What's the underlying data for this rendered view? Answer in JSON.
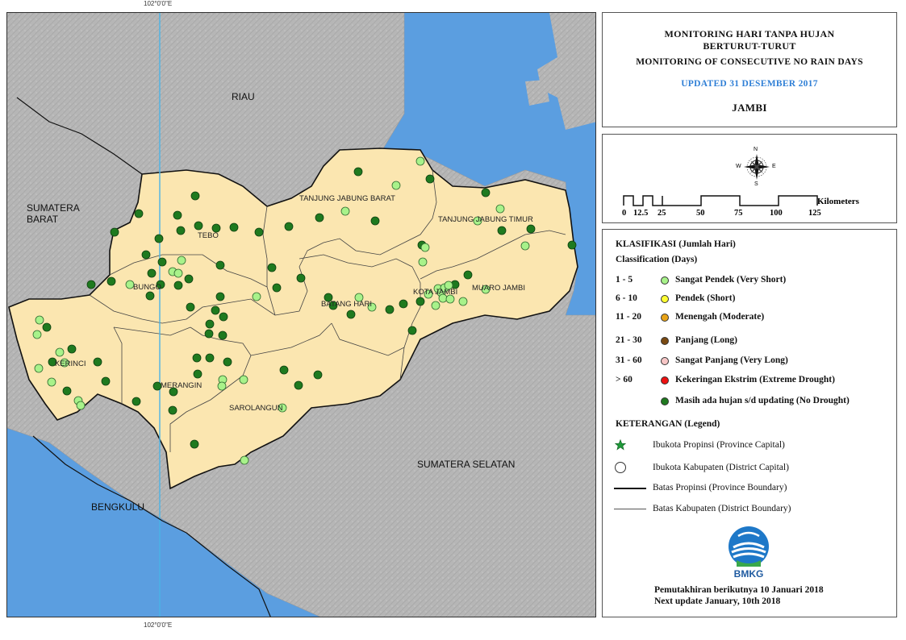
{
  "graticule": {
    "top": "102°0'0\"E",
    "bottom": "102°0'0\"E"
  },
  "regions": {
    "riau": "RIAU",
    "sumbar": [
      "SUMATERA",
      "BARAT"
    ],
    "bengkulu": "BENGKULU",
    "sumsel": "SUMATERA SELATAN"
  },
  "districts": {
    "tjb": "TANJUNG JABUNG BARAT",
    "tjt": "TANJUNG JABUNG TIMUR",
    "tebo": "TEBO",
    "bungo": "BUNGO",
    "kota": "KOTA JAMBI",
    "muaro": "MUARO JAMBI",
    "bh": "BATANG HARI",
    "kerinci": "KERINCI",
    "merangin": "MERANGIN",
    "sarolangun": "SAROLANGUN"
  },
  "title": {
    "line1": "MONITORING HARI TANPA HUJAN",
    "line2": "BERTURUT-TURUT",
    "line3": "MONITORING OF CONSECUTIVE NO RAIN DAYS",
    "updated": "UPDATED 31 DESEMBER 2017",
    "province": "JAMBI"
  },
  "compass": {
    "n": "N",
    "s": "S",
    "e": "E",
    "w": "W"
  },
  "scale": {
    "unit": "Kilometers",
    "ticks": [
      "0",
      "12.5",
      "25",
      "50",
      "75",
      "100",
      "125"
    ]
  },
  "classification": {
    "title": "KLASIFIKASI (Jumlah Hari)",
    "subtitle": "Classification (Days)",
    "items": [
      {
        "code": "1 - 5",
        "label": "Sangat Pendek (Very Short)",
        "color": "#a8f28a"
      },
      {
        "code": "6 - 10",
        "label": "Pendek (Short)",
        "color": "#ffff33"
      },
      {
        "code": "11 - 20",
        "label": "Menengah (Moderate)",
        "color": "#e8a317"
      },
      {
        "code": "21 - 30",
        "label": "Panjang (Long)",
        "color": "#7a4a12"
      },
      {
        "code": "31 - 60",
        "label": "Sangat Panjang (Very Long)",
        "color": "#f7c6c6"
      },
      {
        "code": "> 60",
        "label": "Kekeringan Ekstrim (Extreme Drought)",
        "color": "#ee1111"
      },
      {
        "code": "",
        "label": "Masih ada hujan s/d updating (No Drought)",
        "color": "#1f7a1f"
      }
    ]
  },
  "legend": {
    "title": "KETERANGAN (Legend)",
    "capital": "Ibukota Propinsi (Province Capital)",
    "district_capital": "Ibukota Kabupaten (District Capital)",
    "prov_boundary": "Batas Propinsi (Province Boundary)",
    "dist_boundary": "Batas Kabupaten (District Boundary)"
  },
  "logo": {
    "text": "BMKG"
  },
  "footer": {
    "line1": "Pemutakhiran berikutnya 10 Januari 2018",
    "line2": "Next update January, 10th 2018"
  },
  "colors": {
    "sea": "#5b9ee0",
    "land": "#b5b5b5",
    "jambi": "#fbe6b0",
    "no_drought": "#1f7a1f",
    "very_short": "#a8f28a"
  },
  "stations": {
    "light": [
      [
        520,
        199
      ],
      [
        526,
        306
      ],
      [
        523,
        324
      ],
      [
        490,
        229
      ],
      [
        427,
        261
      ],
      [
        591,
        273
      ],
      [
        619,
        258
      ],
      [
        650,
        304
      ],
      [
        542,
        357
      ],
      [
        546,
        362
      ],
      [
        550,
        356
      ],
      [
        555,
        353
      ],
      [
        548,
        369
      ],
      [
        539,
        378
      ],
      [
        557,
        370
      ],
      [
        573,
        373
      ],
      [
        601,
        358
      ],
      [
        317,
        367
      ],
      [
        444,
        368
      ],
      [
        460,
        380
      ],
      [
        530,
        364
      ],
      [
        224,
        322
      ],
      [
        213,
        336
      ],
      [
        220,
        338
      ],
      [
        160,
        352
      ],
      [
        48,
        396
      ],
      [
        45,
        414
      ],
      [
        73,
        436
      ],
      [
        79,
        449
      ],
      [
        47,
        456
      ],
      [
        63,
        473
      ],
      [
        96,
        496
      ],
      [
        99,
        502
      ],
      [
        275,
        470
      ],
      [
        301,
        470
      ],
      [
        274,
        478
      ],
      [
        302,
        570
      ],
      [
        349,
        505
      ]
    ],
    "dark": [
      [
        443,
        212
      ],
      [
        532,
        221
      ],
      [
        601,
        238
      ],
      [
        464,
        273
      ],
      [
        395,
        269
      ],
      [
        357,
        280
      ],
      [
        621,
        285
      ],
      [
        657,
        283
      ],
      [
        708,
        303
      ],
      [
        522,
        303
      ],
      [
        579,
        340
      ],
      [
        563,
        352
      ],
      [
        520,
        373
      ],
      [
        499,
        376
      ],
      [
        482,
        383
      ],
      [
        510,
        409
      ],
      [
        434,
        389
      ],
      [
        412,
        378
      ],
      [
        406,
        368
      ],
      [
        372,
        344
      ],
      [
        336,
        331
      ],
      [
        320,
        287
      ],
      [
        289,
        281
      ],
      [
        267,
        282
      ],
      [
        245,
        279
      ],
      [
        223,
        285
      ],
      [
        219,
        266
      ],
      [
        241,
        242
      ],
      [
        196,
        295
      ],
      [
        171,
        264
      ],
      [
        141,
        287
      ],
      [
        180,
        315
      ],
      [
        200,
        324
      ],
      [
        187,
        338
      ],
      [
        233,
        345
      ],
      [
        220,
        353
      ],
      [
        198,
        352
      ],
      [
        185,
        366
      ],
      [
        112,
        352
      ],
      [
        137,
        348
      ],
      [
        272,
        328
      ],
      [
        272,
        367
      ],
      [
        266,
        384
      ],
      [
        276,
        392
      ],
      [
        259,
        401
      ],
      [
        258,
        413
      ],
      [
        275,
        415
      ],
      [
        243,
        443
      ],
      [
        259,
        443
      ],
      [
        281,
        448
      ],
      [
        244,
        463
      ],
      [
        214,
        485
      ],
      [
        194,
        478
      ],
      [
        213,
        508
      ],
      [
        168,
        497
      ],
      [
        130,
        472
      ],
      [
        120,
        448
      ],
      [
        88,
        432
      ],
      [
        64,
        448
      ],
      [
        57,
        405
      ],
      [
        82,
        484
      ],
      [
        240,
        550
      ],
      [
        351,
        458
      ],
      [
        393,
        464
      ],
      [
        369,
        477
      ],
      [
        342,
        356
      ],
      [
        235,
        380
      ]
    ]
  }
}
